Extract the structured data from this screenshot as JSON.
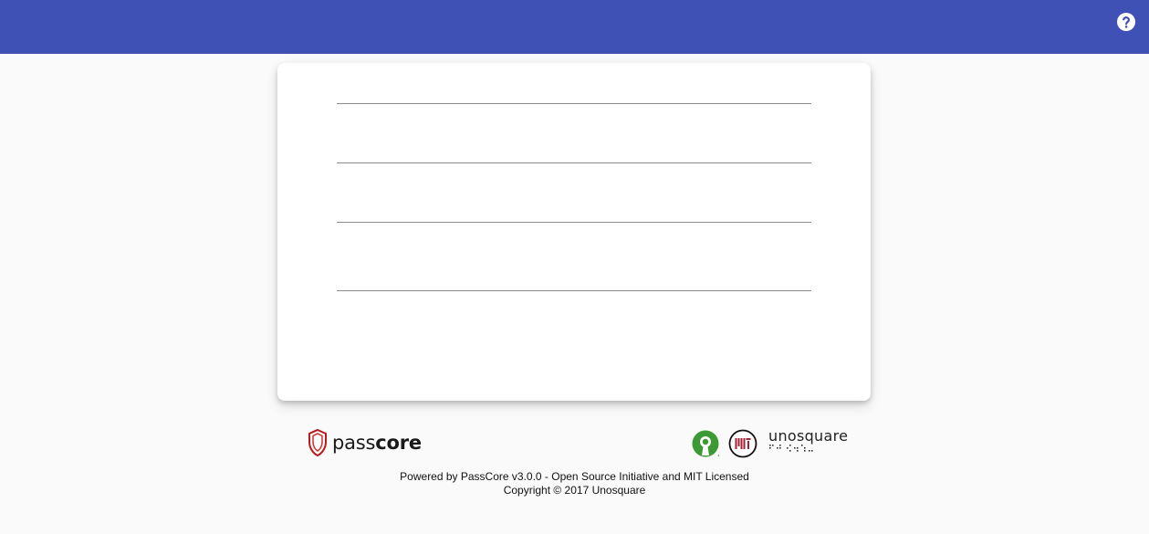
{
  "header": {
    "background_color": "#3f51b5",
    "help_icon": "help-circle-icon"
  },
  "form": {
    "fields": [
      {
        "value": "",
        "placeholder": ""
      },
      {
        "value": "",
        "placeholder": ""
      },
      {
        "value": "",
        "placeholder": ""
      },
      {
        "value": "",
        "placeholder": ""
      }
    ]
  },
  "logos": {
    "passcore": {
      "prefix": "pass",
      "suffix": "core",
      "accent_color": "#b71c1c"
    },
    "osi": {
      "icon": "open-source-initiative-icon",
      "color": "#3c9a34"
    },
    "mit": {
      "icon": "mit-license-icon",
      "color": "#a31f34"
    },
    "unosquare": {
      "text": "unosquare"
    }
  },
  "footer": {
    "powered_by": "Powered by PassCore v3.0.0 - Open Source Initiative and MIT Licensed",
    "copyright": "Copyright © 2017 Unosquare"
  }
}
